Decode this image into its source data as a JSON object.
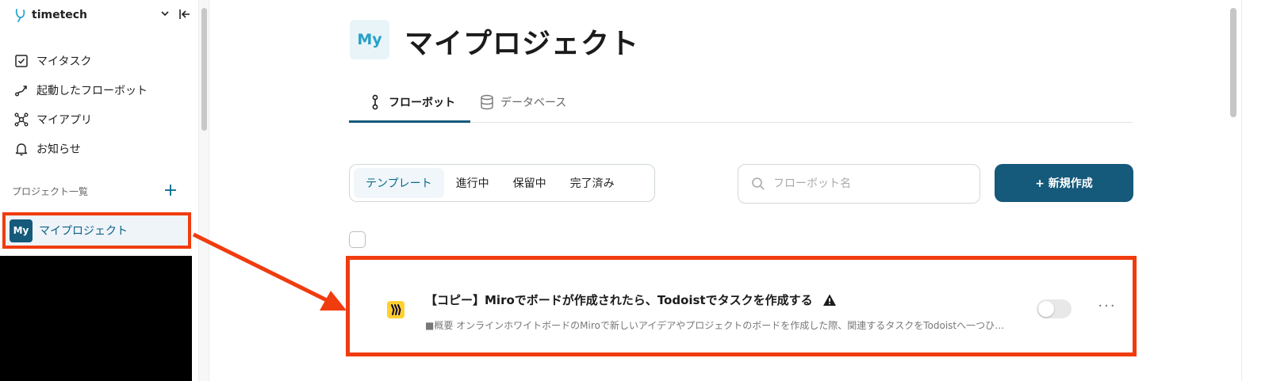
{
  "sidebar": {
    "brand": "timetech",
    "items": [
      {
        "label": "マイタスク",
        "icon": "checkbox-icon"
      },
      {
        "label": "起動したフローボット",
        "icon": "flow-icon"
      },
      {
        "label": "マイアプリ",
        "icon": "apps-icon"
      },
      {
        "label": "お知らせ",
        "icon": "bell-icon"
      }
    ],
    "section_label": "プロジェクト一覧",
    "section_add": "+",
    "project": {
      "badge": "My",
      "label": "マイプロジェクト"
    }
  },
  "header": {
    "badge": "My",
    "title": "マイプロジェクト"
  },
  "tabs": [
    {
      "label": "フローボット",
      "icon": "flow-pin-icon",
      "active": true
    },
    {
      "label": "データベース",
      "icon": "database-icon",
      "active": false
    }
  ],
  "filters": [
    "テンプレート",
    "進行中",
    "保留中",
    "完了済み"
  ],
  "search": {
    "placeholder": "フローボット名"
  },
  "new_button": "+ 新規作成",
  "flow": {
    "title": "【コピー】Miroでボードが作成されたら、Todoistでタスクを作成する",
    "description": "■概要 オンラインホワイトボードのMiroで新しいアイデアやプロジェクトのボードを作成した際、関連するタスクをTodoistへ一つひ…",
    "enabled": false,
    "more": "···"
  },
  "colors": {
    "accent": "#15597b",
    "highlight": "#f03c0f",
    "miro": "#ffd02f"
  }
}
